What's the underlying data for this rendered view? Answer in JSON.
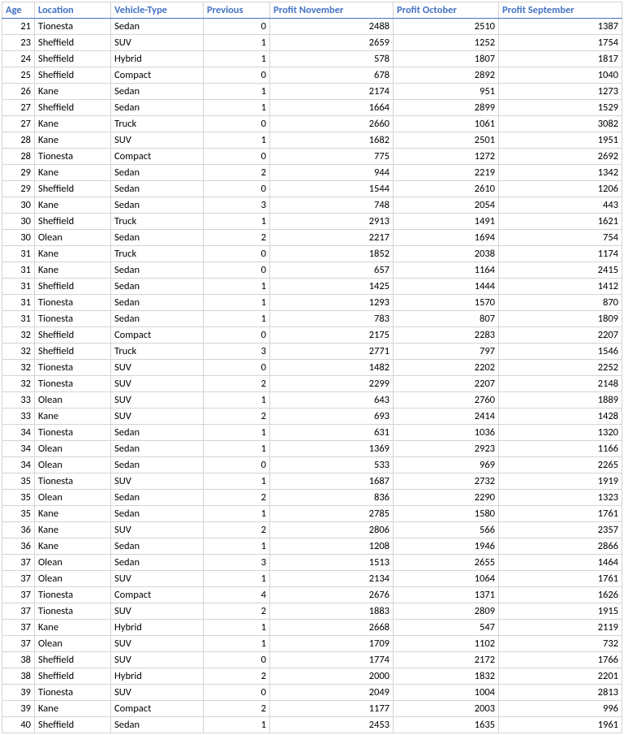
{
  "headers": {
    "age": "Age",
    "location": "Location",
    "vehicle": "Vehicle-Type",
    "previous": "Previous",
    "nov": "Profit November",
    "oct": "Profit October",
    "sep": "Profit September"
  },
  "rows": [
    {
      "age": 21,
      "location": "Tionesta",
      "vehicle": "Sedan",
      "previous": 0,
      "nov": 2488,
      "oct": 2510,
      "sep": 1387
    },
    {
      "age": 23,
      "location": "Sheffield",
      "vehicle": "SUV",
      "previous": 1,
      "nov": 2659,
      "oct": 1252,
      "sep": 1754
    },
    {
      "age": 24,
      "location": "Sheffield",
      "vehicle": "Hybrid",
      "previous": 1,
      "nov": 578,
      "oct": 1807,
      "sep": 1817
    },
    {
      "age": 25,
      "location": "Sheffield",
      "vehicle": "Compact",
      "previous": 0,
      "nov": 678,
      "oct": 2892,
      "sep": 1040
    },
    {
      "age": 26,
      "location": "Kane",
      "vehicle": "Sedan",
      "previous": 1,
      "nov": 2174,
      "oct": 951,
      "sep": 1273
    },
    {
      "age": 27,
      "location": "Sheffield",
      "vehicle": "Sedan",
      "previous": 1,
      "nov": 1664,
      "oct": 2899,
      "sep": 1529
    },
    {
      "age": 27,
      "location": "Kane",
      "vehicle": "Truck",
      "previous": 0,
      "nov": 2660,
      "oct": 1061,
      "sep": 3082
    },
    {
      "age": 28,
      "location": "Kane",
      "vehicle": "SUV",
      "previous": 1,
      "nov": 1682,
      "oct": 2501,
      "sep": 1951
    },
    {
      "age": 28,
      "location": "Tionesta",
      "vehicle": "Compact",
      "previous": 0,
      "nov": 775,
      "oct": 1272,
      "sep": 2692
    },
    {
      "age": 29,
      "location": "Kane",
      "vehicle": "Sedan",
      "previous": 2,
      "nov": 944,
      "oct": 2219,
      "sep": 1342
    },
    {
      "age": 29,
      "location": "Sheffield",
      "vehicle": "Sedan",
      "previous": 0,
      "nov": 1544,
      "oct": 2610,
      "sep": 1206
    },
    {
      "age": 30,
      "location": "Kane",
      "vehicle": "Sedan",
      "previous": 3,
      "nov": 748,
      "oct": 2054,
      "sep": 443
    },
    {
      "age": 30,
      "location": "Sheffield",
      "vehicle": "Truck",
      "previous": 1,
      "nov": 2913,
      "oct": 1491,
      "sep": 1621
    },
    {
      "age": 30,
      "location": "Olean",
      "vehicle": "Sedan",
      "previous": 2,
      "nov": 2217,
      "oct": 1694,
      "sep": 754
    },
    {
      "age": 31,
      "location": "Kane",
      "vehicle": "Truck",
      "previous": 0,
      "nov": 1852,
      "oct": 2038,
      "sep": 1174
    },
    {
      "age": 31,
      "location": "Kane",
      "vehicle": "Sedan",
      "previous": 0,
      "nov": 657,
      "oct": 1164,
      "sep": 2415
    },
    {
      "age": 31,
      "location": "Sheffield",
      "vehicle": "Sedan",
      "previous": 1,
      "nov": 1425,
      "oct": 1444,
      "sep": 1412
    },
    {
      "age": 31,
      "location": "Tionesta",
      "vehicle": "Sedan",
      "previous": 1,
      "nov": 1293,
      "oct": 1570,
      "sep": 870
    },
    {
      "age": 31,
      "location": "Tionesta",
      "vehicle": "Sedan",
      "previous": 1,
      "nov": 783,
      "oct": 807,
      "sep": 1809
    },
    {
      "age": 32,
      "location": "Sheffield",
      "vehicle": "Compact",
      "previous": 0,
      "nov": 2175,
      "oct": 2283,
      "sep": 2207
    },
    {
      "age": 32,
      "location": "Sheffield",
      "vehicle": "Truck",
      "previous": 3,
      "nov": 2771,
      "oct": 797,
      "sep": 1546
    },
    {
      "age": 32,
      "location": "Tionesta",
      "vehicle": "SUV",
      "previous": 0,
      "nov": 1482,
      "oct": 2202,
      "sep": 2252
    },
    {
      "age": 32,
      "location": "Tionesta",
      "vehicle": "SUV",
      "previous": 2,
      "nov": 2299,
      "oct": 2207,
      "sep": 2148
    },
    {
      "age": 33,
      "location": "Olean",
      "vehicle": "SUV",
      "previous": 1,
      "nov": 643,
      "oct": 2760,
      "sep": 1889
    },
    {
      "age": 33,
      "location": "Kane",
      "vehicle": "SUV",
      "previous": 2,
      "nov": 693,
      "oct": 2414,
      "sep": 1428
    },
    {
      "age": 34,
      "location": "Tionesta",
      "vehicle": "Sedan",
      "previous": 1,
      "nov": 631,
      "oct": 1036,
      "sep": 1320
    },
    {
      "age": 34,
      "location": "Olean",
      "vehicle": "Sedan",
      "previous": 1,
      "nov": 1369,
      "oct": 2923,
      "sep": 1166
    },
    {
      "age": 34,
      "location": "Olean",
      "vehicle": "Sedan",
      "previous": 0,
      "nov": 533,
      "oct": 969,
      "sep": 2265
    },
    {
      "age": 35,
      "location": "Tionesta",
      "vehicle": "SUV",
      "previous": 1,
      "nov": 1687,
      "oct": 2732,
      "sep": 1919
    },
    {
      "age": 35,
      "location": "Olean",
      "vehicle": "Sedan",
      "previous": 2,
      "nov": 836,
      "oct": 2290,
      "sep": 1323
    },
    {
      "age": 35,
      "location": "Kane",
      "vehicle": "Sedan",
      "previous": 1,
      "nov": 2785,
      "oct": 1580,
      "sep": 1761
    },
    {
      "age": 36,
      "location": "Kane",
      "vehicle": "SUV",
      "previous": 2,
      "nov": 2806,
      "oct": 566,
      "sep": 2357
    },
    {
      "age": 36,
      "location": "Kane",
      "vehicle": "Sedan",
      "previous": 1,
      "nov": 1208,
      "oct": 1946,
      "sep": 2866
    },
    {
      "age": 37,
      "location": "Olean",
      "vehicle": "Sedan",
      "previous": 3,
      "nov": 1513,
      "oct": 2655,
      "sep": 1464
    },
    {
      "age": 37,
      "location": "Olean",
      "vehicle": "SUV",
      "previous": 1,
      "nov": 2134,
      "oct": 1064,
      "sep": 1761
    },
    {
      "age": 37,
      "location": "Tionesta",
      "vehicle": "Compact",
      "previous": 4,
      "nov": 2676,
      "oct": 1371,
      "sep": 1626
    },
    {
      "age": 37,
      "location": "Tionesta",
      "vehicle": "SUV",
      "previous": 2,
      "nov": 1883,
      "oct": 2809,
      "sep": 1915
    },
    {
      "age": 37,
      "location": "Kane",
      "vehicle": "Hybrid",
      "previous": 1,
      "nov": 2668,
      "oct": 547,
      "sep": 2119
    },
    {
      "age": 37,
      "location": "Olean",
      "vehicle": "SUV",
      "previous": 1,
      "nov": 1709,
      "oct": 1102,
      "sep": 732
    },
    {
      "age": 38,
      "location": "Sheffield",
      "vehicle": "SUV",
      "previous": 0,
      "nov": 1774,
      "oct": 2172,
      "sep": 1766
    },
    {
      "age": 38,
      "location": "Sheffield",
      "vehicle": "Hybrid",
      "previous": 2,
      "nov": 2000,
      "oct": 1832,
      "sep": 2201
    },
    {
      "age": 39,
      "location": "Tionesta",
      "vehicle": "SUV",
      "previous": 0,
      "nov": 2049,
      "oct": 1004,
      "sep": 2813
    },
    {
      "age": 39,
      "location": "Kane",
      "vehicle": "Compact",
      "previous": 2,
      "nov": 1177,
      "oct": 2003,
      "sep": 996
    },
    {
      "age": 40,
      "location": "Sheffield",
      "vehicle": "Sedan",
      "previous": 1,
      "nov": 2453,
      "oct": 1635,
      "sep": 1961
    }
  ]
}
